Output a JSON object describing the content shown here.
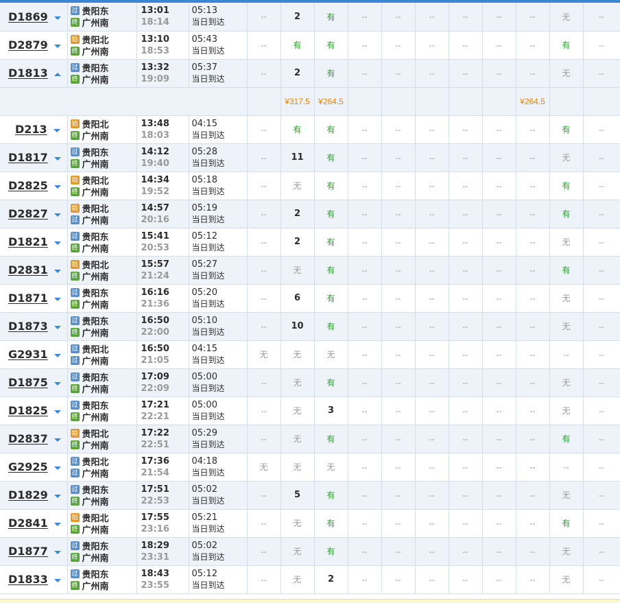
{
  "price_row": {
    "c6": "¥317.5",
    "c7": "¥264.5",
    "c13": "¥264.5"
  },
  "day_label": "当日到达",
  "trains": [
    {
      "no": "D1869",
      "from": "贵阳东",
      "fb": "过",
      "to": "广州南",
      "tb": "终",
      "dep": "13:01",
      "arr": "18:14",
      "dur": "05:13",
      "seats": [
        "--",
        "2",
        "有",
        "--",
        "--",
        "--",
        "--",
        "--",
        "--",
        "无",
        "--"
      ]
    },
    {
      "no": "D2879",
      "from": "贵阳北",
      "fb": "始",
      "to": "广州南",
      "tb": "终",
      "dep": "13:10",
      "arr": "18:53",
      "dur": "05:43",
      "seats": [
        "--",
        "有",
        "有",
        "--",
        "--",
        "--",
        "--",
        "--",
        "--",
        "有",
        "--"
      ]
    },
    {
      "no": "D1813",
      "from": "贵阳东",
      "fb": "过",
      "to": "广州南",
      "tb": "终",
      "dep": "13:32",
      "arr": "19:09",
      "dur": "05:37",
      "seats": [
        "--",
        "2",
        "有",
        "--",
        "--",
        "--",
        "--",
        "--",
        "--",
        "无",
        "--"
      ],
      "expanded": true
    },
    {
      "no": "D213",
      "from": "贵阳北",
      "fb": "始",
      "to": "广州南",
      "tb": "终",
      "dep": "13:48",
      "arr": "18:03",
      "dur": "04:15",
      "seats": [
        "--",
        "有",
        "有",
        "--",
        "--",
        "--",
        "--",
        "--",
        "--",
        "有",
        "--"
      ]
    },
    {
      "no": "D1817",
      "from": "贵阳东",
      "fb": "过",
      "to": "广州南",
      "tb": "终",
      "dep": "14:12",
      "arr": "19:40",
      "dur": "05:28",
      "seats": [
        "--",
        "11",
        "有",
        "--",
        "--",
        "--",
        "--",
        "--",
        "--",
        "无",
        "--"
      ]
    },
    {
      "no": "D2825",
      "from": "贵阳北",
      "fb": "始",
      "to": "广州南",
      "tb": "终",
      "dep": "14:34",
      "arr": "19:52",
      "dur": "05:18",
      "seats": [
        "--",
        "无",
        "有",
        "--",
        "--",
        "--",
        "--",
        "--",
        "--",
        "有",
        "--"
      ]
    },
    {
      "no": "D2827",
      "from": "贵阳北",
      "fb": "始",
      "to": "广州南",
      "tb": "过",
      "dep": "14:57",
      "arr": "20:16",
      "dur": "05:19",
      "seats": [
        "--",
        "2",
        "有",
        "--",
        "--",
        "--",
        "--",
        "--",
        "--",
        "有",
        "--"
      ]
    },
    {
      "no": "D1821",
      "from": "贵阳东",
      "fb": "过",
      "to": "广州南",
      "tb": "终",
      "dep": "15:41",
      "arr": "20:53",
      "dur": "05:12",
      "seats": [
        "--",
        "2",
        "有",
        "--",
        "--",
        "--",
        "--",
        "--",
        "--",
        "无",
        "--"
      ]
    },
    {
      "no": "D2831",
      "from": "贵阳北",
      "fb": "始",
      "to": "广州南",
      "tb": "终",
      "dep": "15:57",
      "arr": "21:24",
      "dur": "05:27",
      "seats": [
        "--",
        "无",
        "有",
        "--",
        "--",
        "--",
        "--",
        "--",
        "--",
        "有",
        "--"
      ]
    },
    {
      "no": "D1871",
      "from": "贵阳东",
      "fb": "过",
      "to": "广州南",
      "tb": "终",
      "dep": "16:16",
      "arr": "21:36",
      "dur": "05:20",
      "seats": [
        "--",
        "6",
        "有",
        "--",
        "--",
        "--",
        "--",
        "--",
        "--",
        "无",
        "--"
      ]
    },
    {
      "no": "D1873",
      "from": "贵阳东",
      "fb": "过",
      "to": "广州南",
      "tb": "终",
      "dep": "16:50",
      "arr": "22:00",
      "dur": "05:10",
      "seats": [
        "--",
        "10",
        "有",
        "--",
        "--",
        "--",
        "--",
        "--",
        "--",
        "无",
        "--"
      ]
    },
    {
      "no": "G2931",
      "from": "贵阳北",
      "fb": "过",
      "to": "广州南",
      "tb": "过",
      "dep": "16:50",
      "arr": "21:05",
      "dur": "04:15",
      "seats": [
        "无",
        "无",
        "无",
        "--",
        "--",
        "--",
        "--",
        "--",
        "--",
        "--",
        "--"
      ]
    },
    {
      "no": "D1875",
      "from": "贵阳东",
      "fb": "过",
      "to": "广州南",
      "tb": "终",
      "dep": "17:09",
      "arr": "22:09",
      "dur": "05:00",
      "seats": [
        "--",
        "无",
        "有",
        "--",
        "--",
        "--",
        "--",
        "--",
        "--",
        "无",
        "--"
      ]
    },
    {
      "no": "D1825",
      "from": "贵阳东",
      "fb": "过",
      "to": "广州南",
      "tb": "终",
      "dep": "17:21",
      "arr": "22:21",
      "dur": "05:00",
      "seats": [
        "--",
        "无",
        "3",
        "--",
        "--",
        "--",
        "--",
        "--",
        "--",
        "无",
        "--"
      ]
    },
    {
      "no": "D2837",
      "from": "贵阳北",
      "fb": "始",
      "to": "广州南",
      "tb": "终",
      "dep": "17:22",
      "arr": "22:51",
      "dur": "05:29",
      "seats": [
        "--",
        "无",
        "有",
        "--",
        "--",
        "--",
        "--",
        "--",
        "--",
        "有",
        "--"
      ]
    },
    {
      "no": "G2925",
      "from": "贵阳北",
      "fb": "过",
      "to": "广州南",
      "tb": "过",
      "dep": "17:36",
      "arr": "21:54",
      "dur": "04:18",
      "seats": [
        "无",
        "无",
        "无",
        "--",
        "--",
        "--",
        "--",
        "--",
        "--",
        "--",
        "--"
      ]
    },
    {
      "no": "D1829",
      "from": "贵阳东",
      "fb": "过",
      "to": "广州南",
      "tb": "终",
      "dep": "17:51",
      "arr": "22:53",
      "dur": "05:02",
      "seats": [
        "--",
        "5",
        "有",
        "--",
        "--",
        "--",
        "--",
        "--",
        "--",
        "无",
        "--"
      ]
    },
    {
      "no": "D2841",
      "from": "贵阳北",
      "fb": "始",
      "to": "广州南",
      "tb": "终",
      "dep": "17:55",
      "arr": "23:16",
      "dur": "05:21",
      "seats": [
        "--",
        "无",
        "有",
        "--",
        "--",
        "--",
        "--",
        "--",
        "--",
        "有",
        "--"
      ]
    },
    {
      "no": "D1877",
      "from": "贵阳东",
      "fb": "过",
      "to": "广州南",
      "tb": "终",
      "dep": "18:29",
      "arr": "23:31",
      "dur": "05:02",
      "seats": [
        "--",
        "无",
        "有",
        "--",
        "--",
        "--",
        "--",
        "--",
        "--",
        "无",
        "--"
      ]
    },
    {
      "no": "D1833",
      "from": "贵阳东",
      "fb": "过",
      "to": "广州南",
      "tb": "终",
      "dep": "18:43",
      "arr": "23:55",
      "dur": "05:12",
      "seats": [
        "--",
        "无",
        "2",
        "--",
        "--",
        "--",
        "--",
        "--",
        "--",
        "无",
        "--"
      ]
    }
  ]
}
